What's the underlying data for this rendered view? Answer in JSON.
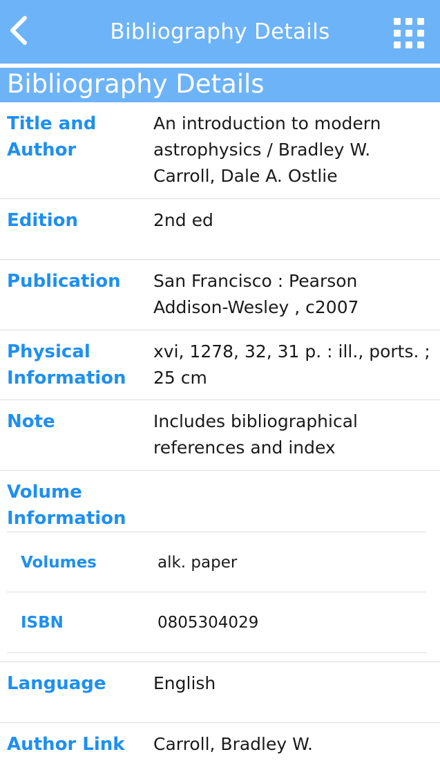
{
  "navbar": {
    "title": "Bibliography Details",
    "back_icon": "chevron-left-icon",
    "menu_icon": "grid-icon",
    "color": "#6db3f8"
  },
  "section": {
    "title": "Bibliography Details"
  },
  "rows": [
    {
      "label": "Title and Author",
      "value": "An introduction to modern astrophysics / Bradley W. Carroll, Dale A. Ostlie"
    },
    {
      "label": "Edition",
      "value": "2nd ed"
    },
    {
      "label": "Publication",
      "value": "San Francisco : Pearson Addison-Wesley , c2007"
    },
    {
      "label": "Physical Information",
      "value": "xvi, 1278, 32, 31 p. : ill., ports. ; 25 cm"
    },
    {
      "label": "Note",
      "value": "Includes bibliographical references and index"
    }
  ],
  "volume_info": {
    "label": "Volume Information",
    "items": [
      {
        "label": "Volumes",
        "value": "alk. paper"
      },
      {
        "label": "ISBN",
        "value": "0805304029"
      }
    ]
  },
  "language": {
    "label": "Language",
    "value": "English"
  },
  "author_link": {
    "label": "Author Link",
    "value": "Carroll, Bradley W."
  },
  "colors": {
    "accent": "#6db3f8",
    "label_text": "#1e8ff0",
    "value_text": "#1a1a1a"
  }
}
